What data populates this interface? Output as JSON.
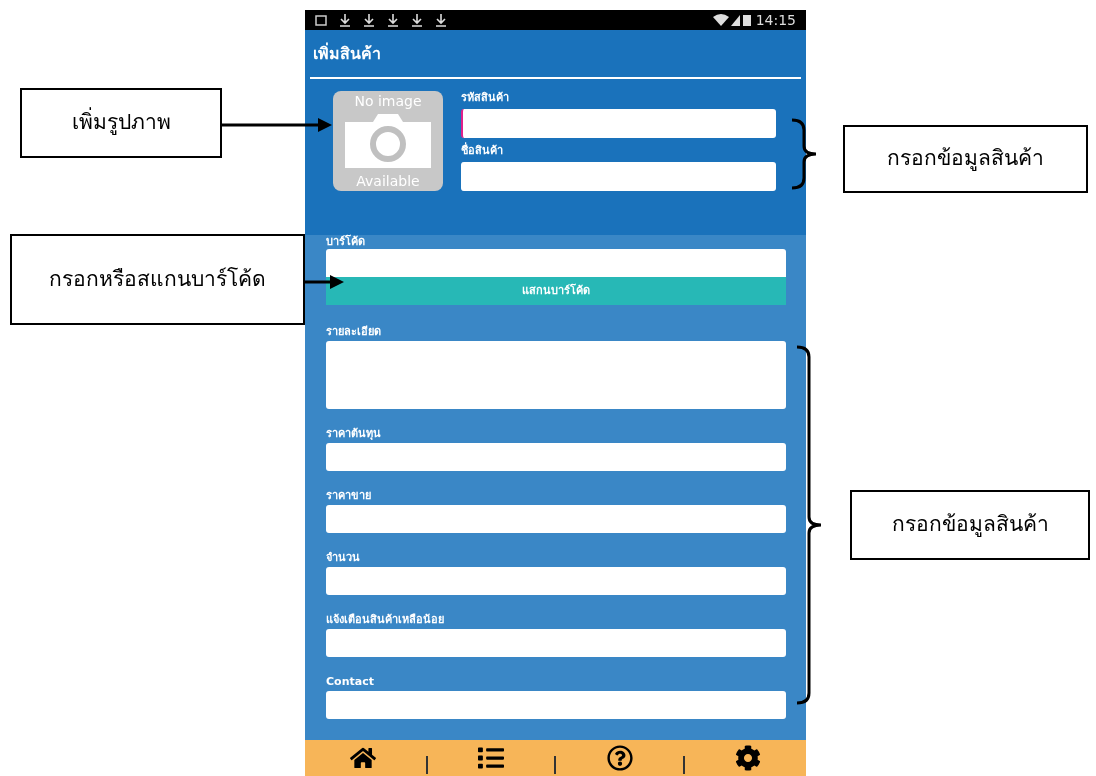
{
  "status_bar": {
    "time": "14:15"
  },
  "header": {
    "title": "เพิ่มสินค้า"
  },
  "image_placeholder": {
    "top_text": "No image",
    "bottom_text": "Available"
  },
  "top_fields": [
    {
      "label": "รหัสสินค้า",
      "focused": true
    },
    {
      "label": "ชื่อสินค้า",
      "focused": false
    }
  ],
  "barcode": {
    "label": "บาร์โค้ด",
    "button": "แสกนบาร์โค้ด"
  },
  "fields": [
    {
      "label": "รายละเอียด",
      "kind": "multiline"
    },
    {
      "label": "ราคาต้นทุน",
      "kind": "line"
    },
    {
      "label": "ราคาขาย",
      "kind": "line"
    },
    {
      "label": "จำนวน",
      "kind": "line"
    },
    {
      "label": "แจ้งเตือนสินค้าเหลือน้อย",
      "kind": "line"
    },
    {
      "label": "Contact",
      "kind": "line"
    }
  ],
  "bottom_nav": [
    {
      "kind": "home"
    },
    {
      "kind": "list"
    },
    {
      "kind": "help"
    },
    {
      "kind": "settings"
    }
  ],
  "annotations": [
    {
      "text": "เพิ่มรูปภาพ",
      "kind": "left-image"
    },
    {
      "text": "กรอกหรือสแกนบาร์โค้ด",
      "kind": "left-barcode"
    },
    {
      "text": "กรอกข้อมูลสินค้า",
      "kind": "right-top"
    },
    {
      "text": "กรอกข้อมูลสินค้า",
      "kind": "right-bottom"
    }
  ]
}
